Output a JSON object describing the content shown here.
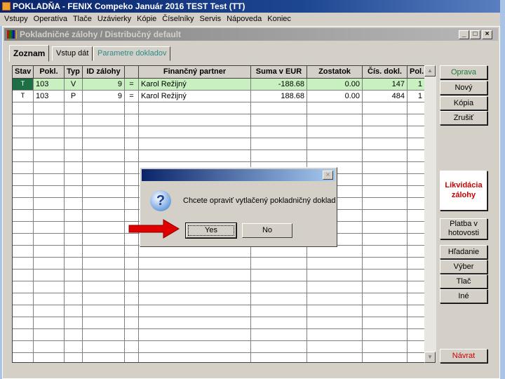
{
  "app": {
    "title": "POKLADŇA - FENIX Compeko  Január 2016  TEST Test  (TT)"
  },
  "menu": [
    "Vstupy",
    "Operatíva",
    "Tlače",
    "Uzávierky",
    "Kópie",
    "Číselníky",
    "Servis",
    "Nápoveda",
    "Koniec"
  ],
  "window": {
    "title": "Pokladničné zálohy / Distribučný default",
    "minimize": "_",
    "maximize": "□",
    "close": "×"
  },
  "tabs": [
    "Zoznam",
    "Vstup dát",
    "Parametre dokladov"
  ],
  "table": {
    "columns": [
      "Stav",
      "Pokl.",
      "Typ",
      "ID zálohy",
      "",
      "Finančný partner",
      "Suma v EUR",
      "Zostatok",
      "Čís. dokl.",
      "Pol."
    ],
    "rows": [
      [
        "T",
        "103",
        "V",
        "9",
        "=",
        "Karol Režijný",
        "-188.68",
        "0.00",
        "147",
        "1"
      ],
      [
        "T",
        "103",
        "P",
        "9",
        "=",
        "Karol Režijný",
        "188.68",
        "0.00",
        "484",
        "1"
      ]
    ]
  },
  "scroll": {
    "up": "▲",
    "down": "▼"
  },
  "buttons": {
    "oprava": "Oprava",
    "novy": "Nový",
    "kopia": "Kópia",
    "zrusit": "Zrušiť",
    "likvidacia1": "Likvidácia",
    "likvidacia2": "zálohy",
    "platba1": "Platba v",
    "platba2": "hotovosti",
    "hladanie": "Hľadanie",
    "vyber": "Výber",
    "tlac": "Tlač",
    "ine": "Iné",
    "navrat": "Návrat"
  },
  "dialog": {
    "message": "Chcete opraviť vytlačený pokladničný doklad",
    "yes": "Yes",
    "no": "No",
    "close": "×",
    "icon": "?"
  },
  "colors": {
    "selected_row": "#c8f0c0",
    "status_cell": "#1e6e46",
    "highlight": "#cc0000"
  }
}
